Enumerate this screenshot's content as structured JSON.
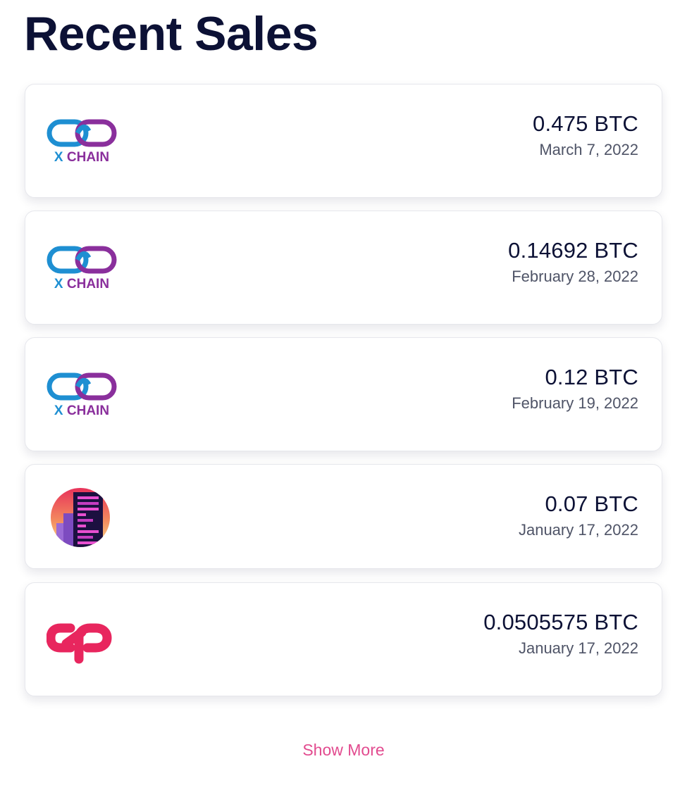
{
  "page": {
    "title": "Recent Sales"
  },
  "colors": {
    "title": "#0c1135",
    "price": "#0c1135",
    "date": "#4f5467",
    "link": "#e24b8f",
    "xchain_blue": "#1e8fd2",
    "xchain_purple": "#8a2f9c",
    "counterparty_red": "#e8265e"
  },
  "sales": [
    {
      "logo": "xchain-logo",
      "logo_text": "XCHAIN",
      "price": "0.475 BTC",
      "date": "March 7, 2022"
    },
    {
      "logo": "xchain-logo",
      "logo_text": "XCHAIN",
      "price": "0.14692 BTC",
      "date": "February 28, 2022"
    },
    {
      "logo": "xchain-logo",
      "logo_text": "XCHAIN",
      "price": "0.12 BTC",
      "date": "February 19, 2022"
    },
    {
      "logo": "pixel-city-icon",
      "price": "0.07 BTC",
      "date": "January 17, 2022"
    },
    {
      "logo": "counterparty-logo",
      "price": "0.0505575 BTC",
      "date": "January 17, 2022"
    }
  ],
  "show_more_label": "Show More"
}
